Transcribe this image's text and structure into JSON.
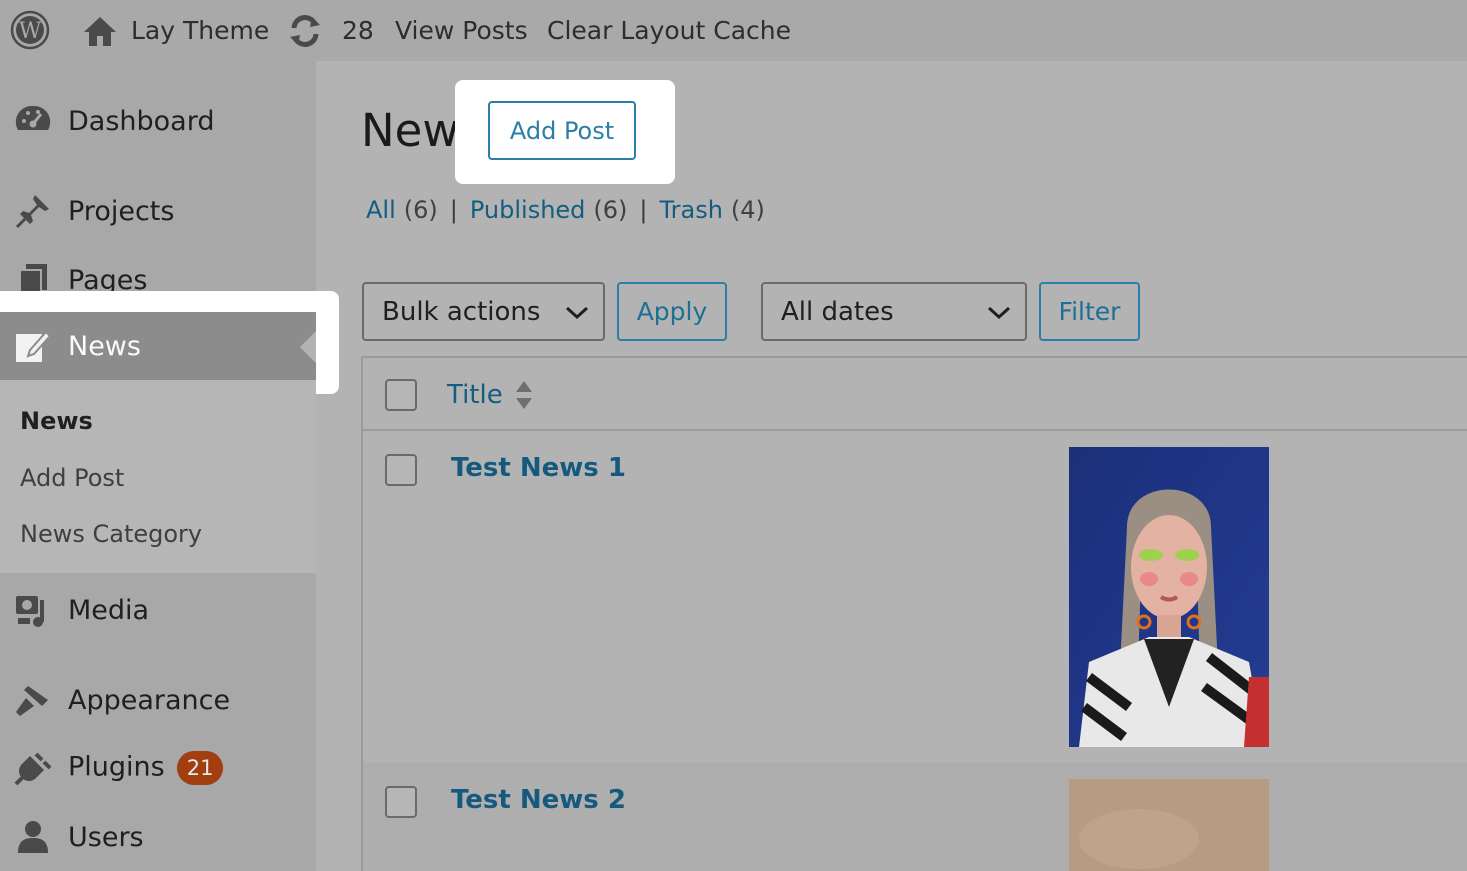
{
  "adminbar": {
    "site_name": "Lay Theme",
    "updates_count": "28",
    "view_posts": "View Posts",
    "clear_cache": "Clear Layout Cache"
  },
  "sidebar": {
    "items": [
      {
        "label": "Dashboard",
        "icon": "dashboard-icon"
      },
      {
        "label": "Projects",
        "icon": "pin-icon"
      },
      {
        "label": "Pages",
        "icon": "pages-icon"
      },
      {
        "label": "News",
        "icon": "edit-post-icon"
      },
      {
        "label": "Media",
        "icon": "media-icon"
      },
      {
        "label": "Appearance",
        "icon": "appearance-icon"
      },
      {
        "label": "Plugins",
        "icon": "plugins-icon",
        "badge": "21"
      },
      {
        "label": "Users",
        "icon": "users-icon"
      }
    ],
    "submenu": [
      {
        "label": "News"
      },
      {
        "label": "Add Post"
      },
      {
        "label": "News Category"
      }
    ]
  },
  "main": {
    "title": "News",
    "add_button": "Add Post",
    "filters": {
      "all": {
        "label": "All",
        "count": "(6)"
      },
      "published": {
        "label": "Published",
        "count": "(6)"
      },
      "trash": {
        "label": "Trash",
        "count": "(4)"
      }
    },
    "bulk_actions": "Bulk actions",
    "apply": "Apply",
    "dates": "All dates",
    "filter": "Filter",
    "table": {
      "column_title": "Title",
      "rows": [
        {
          "title": "Test News 1"
        },
        {
          "title": "Test News 2"
        }
      ]
    }
  },
  "colors": {
    "accent": "#2a7ea8",
    "link": "#135d82",
    "badge": "#a33e10"
  }
}
